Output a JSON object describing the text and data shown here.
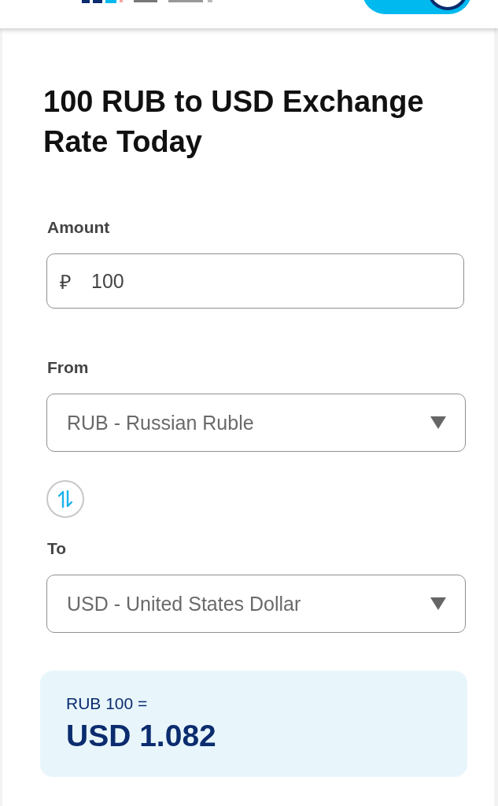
{
  "title": "100 RUB to USD Exchange Rate Today",
  "amount": {
    "label": "Amount",
    "currency_symbol": "₽",
    "value": "100"
  },
  "from": {
    "label": "From",
    "value": "RUB - Russian Ruble"
  },
  "to": {
    "label": "To",
    "value": "USD - United States Dollar"
  },
  "result": {
    "base": "RUB 100 =",
    "converted": "USD 1.082"
  }
}
